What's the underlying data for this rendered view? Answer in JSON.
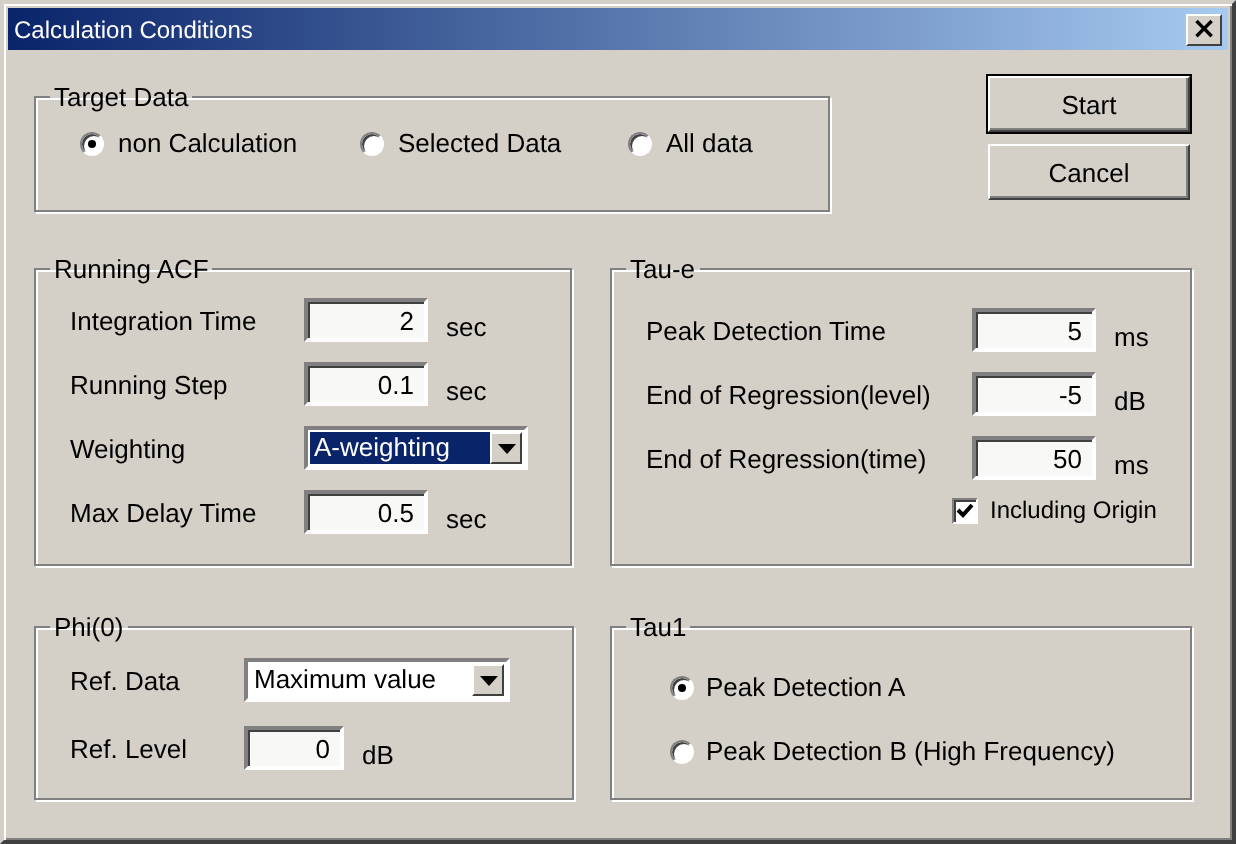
{
  "window": {
    "title": "Calculation Conditions",
    "close": "×"
  },
  "target_data": {
    "title": "Target Data",
    "options": [
      {
        "label": "non Calculation",
        "selected": true
      },
      {
        "label": "Selected Data",
        "selected": false
      },
      {
        "label": "All data",
        "selected": false
      }
    ]
  },
  "buttons": [
    {
      "label": "Start",
      "default": true
    },
    {
      "label": "Cancel",
      "default": false
    }
  ],
  "running_acf": {
    "title": "Running ACF",
    "rows": [
      {
        "kind": "field",
        "label": "Integration Time",
        "value": "2",
        "unit": "sec"
      },
      {
        "kind": "field",
        "label": "Running Step",
        "value": "0.1",
        "unit": "sec"
      },
      {
        "kind": "dropdown",
        "label": "Weighting",
        "value": "A-weighting",
        "focused": true
      },
      {
        "kind": "field",
        "label": "Max Delay Time",
        "value": "0.5",
        "unit": "sec"
      }
    ]
  },
  "tau_e": {
    "title": "Tau-e",
    "rows": [
      {
        "kind": "field",
        "label": "Peak Detection Time",
        "value": "5",
        "unit": "ms"
      },
      {
        "kind": "field",
        "label": "End of Regression(level)",
        "value": "-5",
        "unit": "dB"
      },
      {
        "kind": "field",
        "label": "End of Regression(time)",
        "value": "50",
        "unit": "ms"
      }
    ],
    "checkbox": {
      "label": "Including Origin",
      "checked": true
    }
  },
  "phi0": {
    "title": "Phi(0)",
    "rows": [
      {
        "kind": "dropdown",
        "label": "Ref. Data",
        "value": "Maximum value",
        "focused": false
      },
      {
        "kind": "field",
        "label": "Ref. Level",
        "value": "0",
        "unit": "dB"
      }
    ]
  },
  "tau1": {
    "title": "Tau1",
    "options": [
      {
        "label": "Peak Detection A",
        "selected": true
      },
      {
        "label": "Peak Detection B (High Frequency)",
        "selected": false
      }
    ]
  }
}
